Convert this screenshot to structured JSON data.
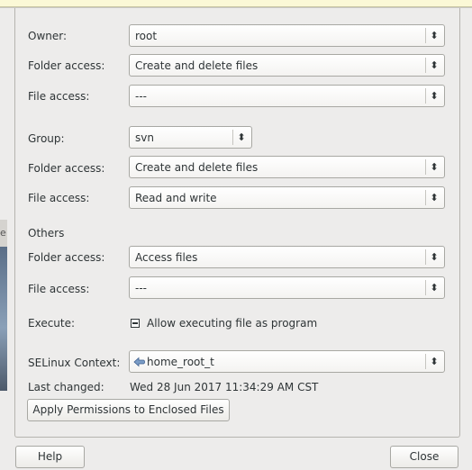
{
  "owner": {
    "label": "Owner:",
    "value": "root",
    "folder_access_label": "Folder access:",
    "folder_access": "Create and delete files",
    "file_access_label": "File access:",
    "file_access": "---"
  },
  "group": {
    "label": "Group:",
    "value": "svn",
    "folder_access_label": "Folder access:",
    "folder_access": "Create and delete files",
    "file_access_label": "File access:",
    "file_access": "Read and write"
  },
  "others": {
    "heading": "Others",
    "folder_access_label": "Folder access:",
    "folder_access": "Access files",
    "file_access_label": "File access:",
    "file_access": "---"
  },
  "execute": {
    "label": "Execute:",
    "checkbox_label": "Allow executing file as program",
    "state": "indeterminate"
  },
  "selinux": {
    "label": "SELinux Context:",
    "value": "home_root_t"
  },
  "last_changed": {
    "label": "Last changed:",
    "value": "Wed 28 Jun 2017 11:34:29 AM CST"
  },
  "apply_button": "Apply Permissions to Enclosed Files",
  "dialog_buttons": {
    "help": "Help",
    "close": "Close"
  },
  "icons": {
    "combo_arrow": "up-down-chevron-icon",
    "selinux": "selinux-context-icon"
  },
  "colors": {
    "window_bg": "#edeceb",
    "tooltip_strip": "#fbf8d6",
    "border": "#a8a8a3"
  }
}
